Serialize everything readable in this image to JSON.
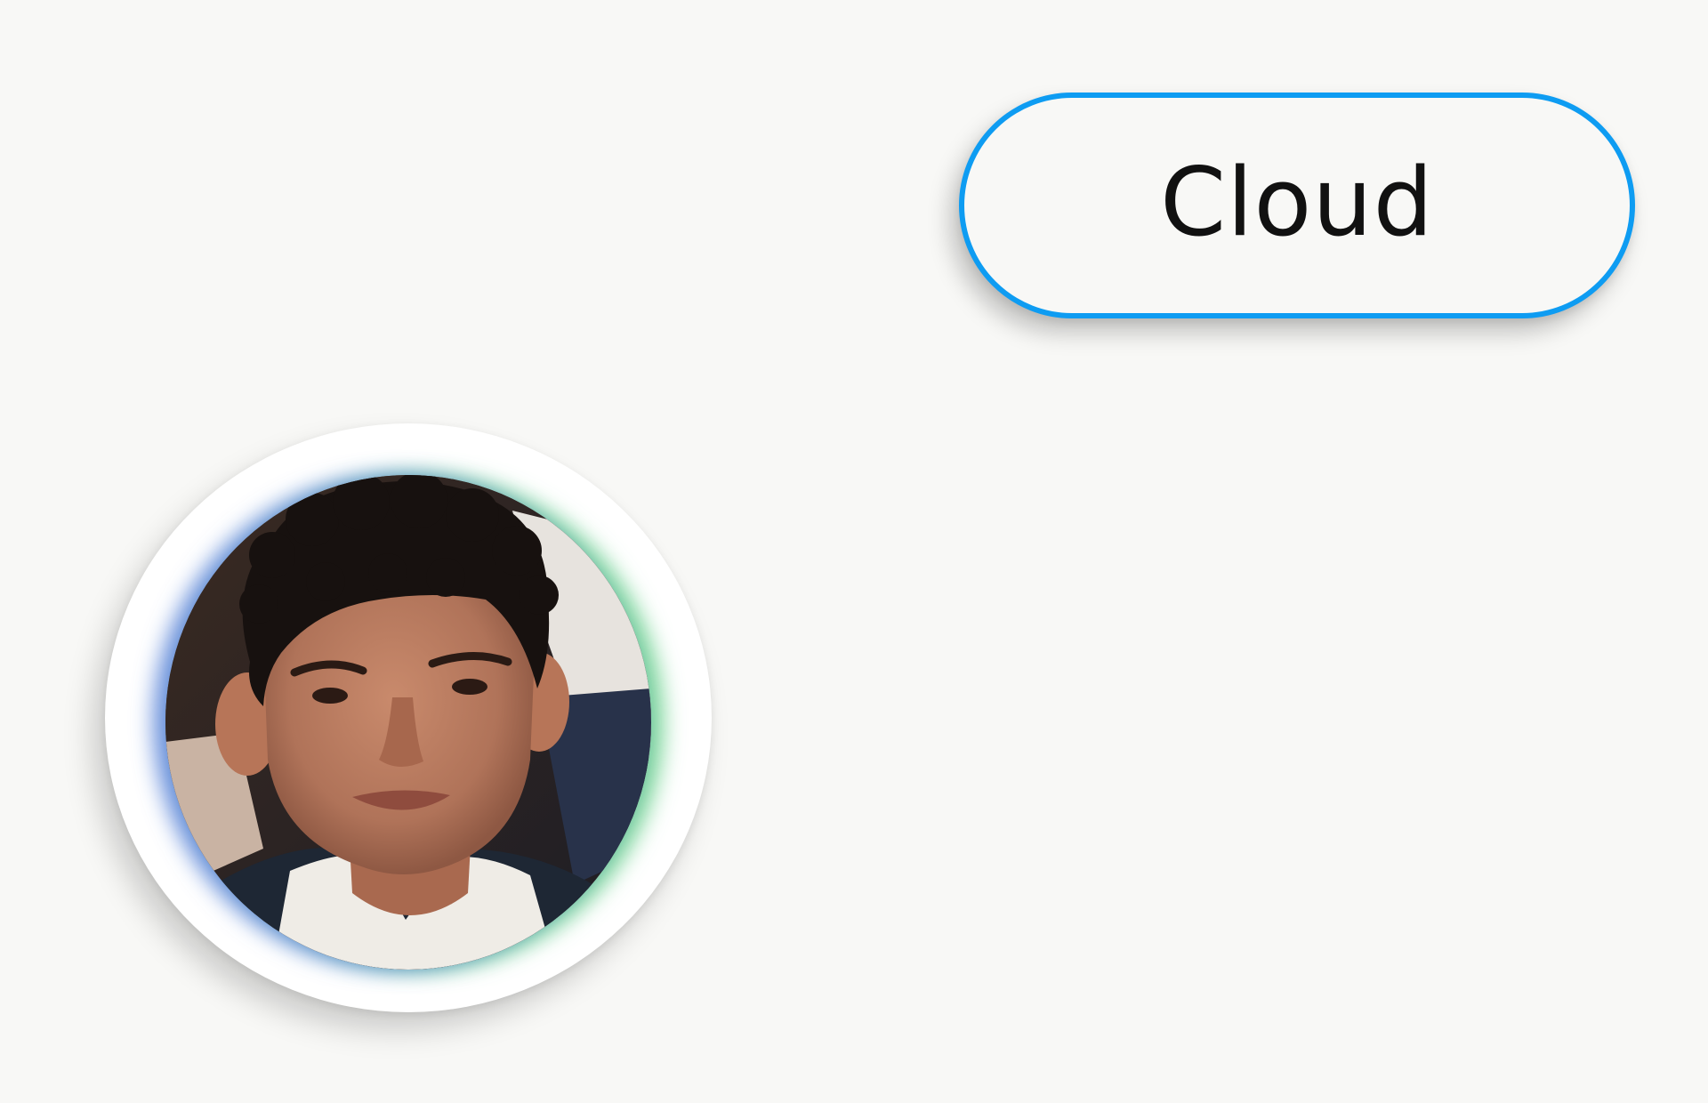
{
  "cloud_button": {
    "label": "Cloud",
    "border_color": "#0e9cf2"
  },
  "avatar": {
    "glow_colors": [
      "#3c6ed2",
      "#50c878"
    ],
    "frame_color": "#ffffff"
  },
  "background_color": "#f8f8f6"
}
